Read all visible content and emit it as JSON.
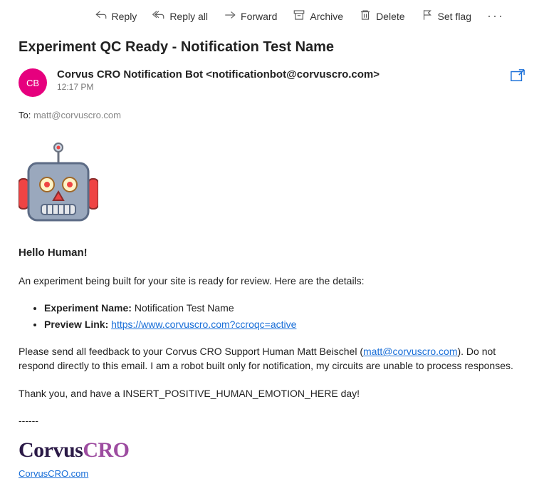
{
  "toolbar": {
    "reply": "Reply",
    "reply_all": "Reply all",
    "forward": "Forward",
    "archive": "Archive",
    "delete": "Delete",
    "set_flag": "Set flag"
  },
  "subject": "Experiment QC Ready - Notification Test Name",
  "avatar_initials": "CB",
  "sender": {
    "display": "Corvus CRO Notification Bot <notificationbot@corvuscro.com>",
    "time": "12:17 PM"
  },
  "to": {
    "label": "To:",
    "value": "matt@corvuscro.com"
  },
  "body": {
    "hello": "Hello Human!",
    "intro": "An experiment being built for your site is ready for review. Here are the details:",
    "experiment_label": "Experiment Name:",
    "experiment_value": "Notification Test Name",
    "preview_label": "Preview Link:",
    "preview_url": "https://www.corvuscro.com?ccroqc=active",
    "feedback_pre": "Please send all feedback to your Corvus CRO Support Human Matt Beischel (",
    "feedback_email": "matt@corvuscro.com",
    "feedback_post": "). Do not respond directly to this email. I am a robot built only for notification, my circuits are unable to process responses.",
    "thanks": "Thank you, and have a INSERT_POSITIVE_HUMAN_EMOTION_HERE day!",
    "divider": "------",
    "logo_corvus": "Corvus",
    "logo_cro": "CRO",
    "site_link": "CorvusCRO.com"
  }
}
